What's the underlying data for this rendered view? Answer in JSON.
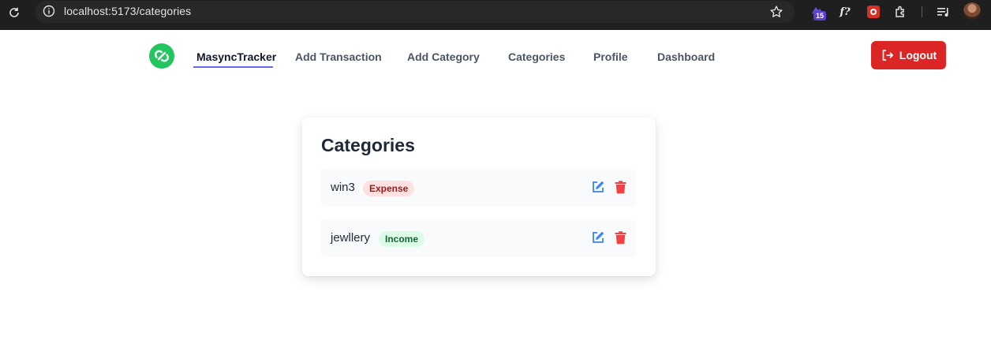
{
  "browser": {
    "url": "localhost:5173/categories",
    "extension_badge": "15",
    "extension_f_label": "f?",
    "icons": [
      "reload-icon",
      "site-info-icon",
      "bookmark-star-icon",
      "extension-icon",
      "puzzle-icon",
      "media-queue-icon",
      "profile-avatar"
    ]
  },
  "nav": {
    "brand": "MasyncTracker",
    "links": [
      "Add Transaction",
      "Add Category",
      "Categories",
      "Profile",
      "Dashboard"
    ],
    "logout_label": "Logout",
    "accent_color": "#6366f1",
    "brand_color": "#22c55e",
    "logout_color": "#dc2626"
  },
  "page": {
    "title": "Categories",
    "categories": [
      {
        "name": "win3",
        "type": "Expense"
      },
      {
        "name": "jewllery",
        "type": "Income"
      }
    ]
  }
}
